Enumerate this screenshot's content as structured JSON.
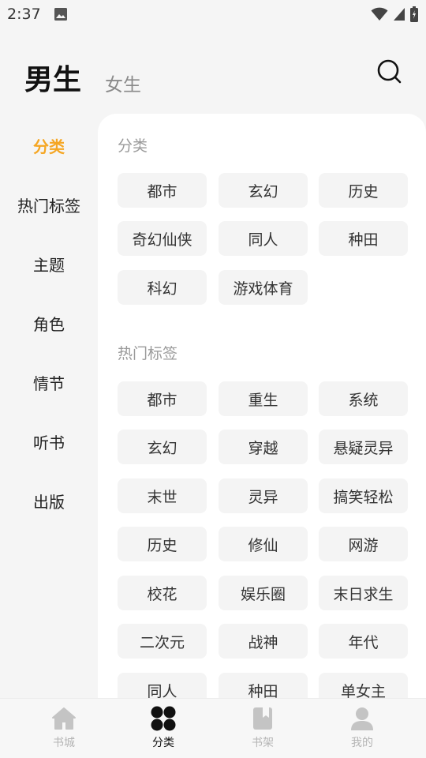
{
  "status_bar": {
    "time": "2:37"
  },
  "header": {
    "tabs": [
      "男生",
      "女生"
    ],
    "active_tab": "男生"
  },
  "sidebar": {
    "items": [
      "分类",
      "热门标签",
      "主题",
      "角色",
      "情节",
      "听书",
      "出版"
    ],
    "active": "分类"
  },
  "sections": [
    {
      "title": "分类",
      "chips": [
        "都市",
        "玄幻",
        "历史",
        "奇幻仙侠",
        "同人",
        "种田",
        "科幻",
        "游戏体育"
      ]
    },
    {
      "title": "热门标签",
      "chips": [
        "都市",
        "重生",
        "系统",
        "玄幻",
        "穿越",
        "悬疑灵异",
        "末世",
        "灵异",
        "搞笑轻松",
        "历史",
        "修仙",
        "网游",
        "校花",
        "娱乐圈",
        "末日求生",
        "二次元",
        "战神",
        "年代",
        "同人",
        "种田",
        "单女主"
      ]
    }
  ],
  "bottom_nav": {
    "items": [
      {
        "label": "书城",
        "icon": "home-icon"
      },
      {
        "label": "分类",
        "icon": "category-icon"
      },
      {
        "label": "书架",
        "icon": "bookshelf-icon"
      },
      {
        "label": "我的",
        "icon": "profile-icon"
      }
    ],
    "active": "分类"
  },
  "colors": {
    "accent": "#f5a623",
    "inactive_nav": "#b5b5b5"
  }
}
